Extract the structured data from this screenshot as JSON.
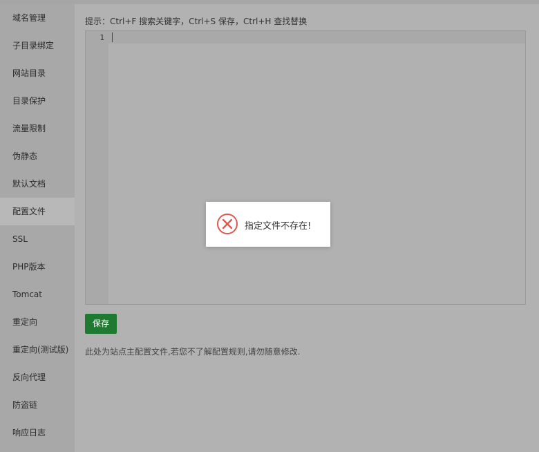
{
  "sidebar": {
    "items": [
      {
        "label": "域名管理"
      },
      {
        "label": "子目录绑定"
      },
      {
        "label": "网站目录"
      },
      {
        "label": "目录保护"
      },
      {
        "label": "流量限制"
      },
      {
        "label": "伪静态"
      },
      {
        "label": "默认文档"
      },
      {
        "label": "配置文件",
        "active": true
      },
      {
        "label": "SSL"
      },
      {
        "label": "PHP版本"
      },
      {
        "label": "Tomcat"
      },
      {
        "label": "重定向"
      },
      {
        "label": "重定向(测试版)"
      },
      {
        "label": "反向代理"
      },
      {
        "label": "防盗链"
      },
      {
        "label": "响应日志"
      }
    ]
  },
  "main": {
    "hint": "提示：Ctrl+F 搜索关键字，Ctrl+S 保存，Ctrl+H 查找替换",
    "editor": {
      "line_number": "1"
    },
    "save_label": "保存",
    "note": "此处为站点主配置文件,若您不了解配置规则,请勿随意修改."
  },
  "modal": {
    "message": "指定文件不存在!",
    "icon": "error-circle-x-icon",
    "icon_color": "#e0574f"
  },
  "colors": {
    "save_button": "#1f7a31"
  }
}
